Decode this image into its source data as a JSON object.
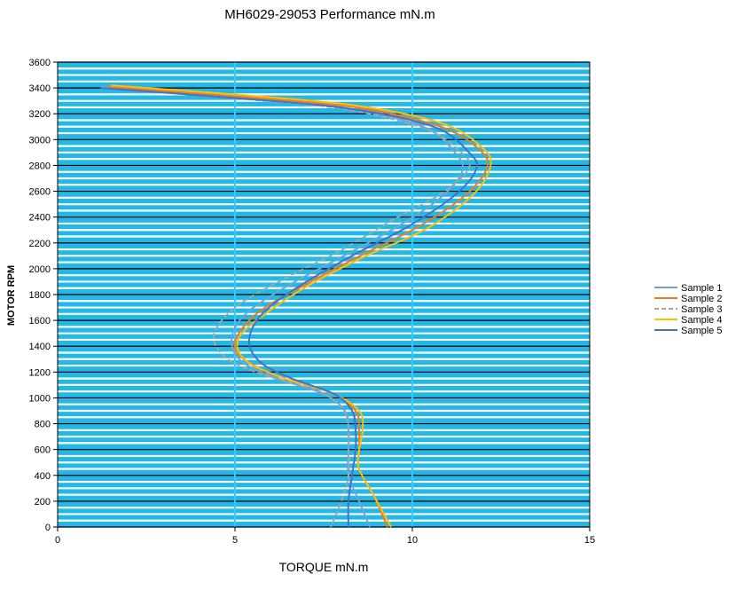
{
  "chart_data": {
    "type": "line",
    "title": "MH6029-29053  Performance mN.m",
    "xlabel": "TORQUE mN.m",
    "ylabel": "MOTOR RPM",
    "xlim": [
      0,
      15
    ],
    "ylim": [
      0,
      3600
    ],
    "xticks": [
      0,
      5,
      10,
      15
    ],
    "yticks": [
      0,
      200,
      400,
      600,
      800,
      1000,
      1200,
      1400,
      1600,
      1800,
      2000,
      2200,
      2400,
      2600,
      2800,
      3000,
      3200,
      3400,
      3600
    ],
    "plot_background": "#24b8e6",
    "major_grid_color": "#000000",
    "minor_grid_color": "#ffffff",
    "vertical_grid_color": "#33ccff",
    "legend_position": "right",
    "series": [
      {
        "name": "Sample 1",
        "color": "#6fa4d8",
        "dash": "solid",
        "points": [
          [
            1.2,
            3410
          ],
          [
            5.0,
            3330
          ],
          [
            8.0,
            3250
          ],
          [
            10.3,
            3100
          ],
          [
            11.2,
            2900
          ],
          [
            11.4,
            2750
          ],
          [
            10.8,
            2550
          ],
          [
            9.6,
            2330
          ],
          [
            8.0,
            2090
          ],
          [
            6.5,
            1870
          ],
          [
            5.3,
            1650
          ],
          [
            4.9,
            1450
          ],
          [
            5.2,
            1280
          ],
          [
            6.2,
            1150
          ],
          [
            7.5,
            1030
          ],
          [
            8.1,
            900
          ],
          [
            8.2,
            750
          ],
          [
            8.2,
            600
          ],
          [
            8.2,
            400
          ],
          [
            8.5,
            200
          ],
          [
            8.8,
            0
          ]
        ]
      },
      {
        "name": "Sample 2",
        "color": "#f07c1f",
        "dash": "solid",
        "points": [
          [
            1.4,
            3410
          ],
          [
            5.3,
            3330
          ],
          [
            8.4,
            3250
          ],
          [
            10.8,
            3100
          ],
          [
            11.9,
            2920
          ],
          [
            12.1,
            2780
          ],
          [
            11.5,
            2570
          ],
          [
            10.2,
            2330
          ],
          [
            8.6,
            2110
          ],
          [
            7.0,
            1880
          ],
          [
            5.6,
            1650
          ],
          [
            5.0,
            1430
          ],
          [
            5.3,
            1290
          ],
          [
            6.3,
            1160
          ],
          [
            7.7,
            1040
          ],
          [
            8.4,
            900
          ],
          [
            8.5,
            750
          ],
          [
            8.5,
            600
          ],
          [
            8.5,
            450
          ],
          [
            8.9,
            250
          ],
          [
            9.3,
            0
          ]
        ]
      },
      {
        "name": "Sample 3",
        "color": "#a5a5a5",
        "dash": "dashed",
        "points": [
          [
            1.3,
            3400
          ],
          [
            5.0,
            3320
          ],
          [
            8.0,
            3240
          ],
          [
            10.3,
            3090
          ],
          [
            11.3,
            2920
          ],
          [
            11.6,
            2780
          ],
          [
            10.8,
            2580
          ],
          [
            9.4,
            2370
          ],
          [
            7.9,
            2130
          ],
          [
            6.3,
            1910
          ],
          [
            5.0,
            1700
          ],
          [
            4.4,
            1480
          ],
          [
            4.8,
            1300
          ],
          [
            5.9,
            1170
          ],
          [
            7.3,
            1060
          ],
          [
            8.0,
            930
          ],
          [
            8.2,
            780
          ],
          [
            8.2,
            600
          ],
          [
            8.2,
            400
          ],
          [
            8.0,
            200
          ],
          [
            7.7,
            0
          ]
        ]
      },
      {
        "name": "Sample 4",
        "color": "#ffc000",
        "dash": "solid",
        "points": [
          [
            1.5,
            3420
          ],
          [
            5.4,
            3340
          ],
          [
            8.5,
            3260
          ],
          [
            10.9,
            3120
          ],
          [
            12.0,
            2930
          ],
          [
            12.2,
            2790
          ],
          [
            11.7,
            2570
          ],
          [
            10.4,
            2310
          ],
          [
            8.7,
            2100
          ],
          [
            7.2,
            1890
          ],
          [
            5.9,
            1660
          ],
          [
            5.1,
            1460
          ],
          [
            5.3,
            1290
          ],
          [
            6.3,
            1160
          ],
          [
            7.7,
            1040
          ],
          [
            8.5,
            900
          ],
          [
            8.6,
            750
          ],
          [
            8.5,
            600
          ],
          [
            8.5,
            450
          ],
          [
            8.9,
            250
          ],
          [
            9.4,
            0
          ]
        ]
      },
      {
        "name": "Sample 5",
        "color": "#4472c4",
        "dash": "solid",
        "points": [
          [
            1.2,
            3400
          ],
          [
            5.1,
            3320
          ],
          [
            8.2,
            3240
          ],
          [
            10.6,
            3100
          ],
          [
            11.6,
            2900
          ],
          [
            11.8,
            2770
          ],
          [
            11.2,
            2570
          ],
          [
            9.9,
            2330
          ],
          [
            8.3,
            2100
          ],
          [
            6.9,
            1880
          ],
          [
            5.8,
            1660
          ],
          [
            5.4,
            1450
          ],
          [
            5.7,
            1280
          ],
          [
            6.6,
            1150
          ],
          [
            7.8,
            1030
          ],
          [
            8.3,
            900
          ],
          [
            8.4,
            750
          ],
          [
            8.4,
            600
          ],
          [
            8.3,
            400
          ],
          [
            8.2,
            200
          ],
          [
            8.2,
            0
          ]
        ]
      }
    ]
  }
}
